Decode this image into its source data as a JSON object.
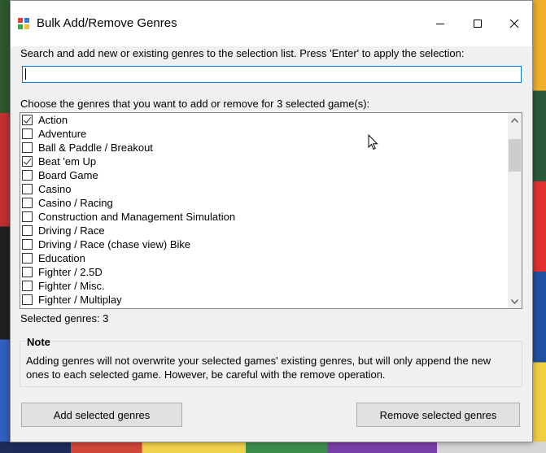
{
  "window": {
    "title": "Bulk Add/Remove Genres"
  },
  "search": {
    "label": "Search and add new or existing genres to the selection list. Press 'Enter' to apply the selection:",
    "value": "",
    "placeholder": ""
  },
  "genres": {
    "label": "Choose the genres that you want to add or remove for 3 selected game(s):",
    "items": [
      {
        "label": "Action",
        "checked": true
      },
      {
        "label": "Adventure",
        "checked": false
      },
      {
        "label": "Ball & Paddle / Breakout",
        "checked": false
      },
      {
        "label": "Beat 'em Up",
        "checked": true
      },
      {
        "label": "Board Game",
        "checked": false
      },
      {
        "label": "Casino",
        "checked": false
      },
      {
        "label": "Casino / Racing",
        "checked": false
      },
      {
        "label": "Construction and Management Simulation",
        "checked": false
      },
      {
        "label": "Driving / Race",
        "checked": false
      },
      {
        "label": "Driving / Race (chase view) Bike",
        "checked": false
      },
      {
        "label": "Education",
        "checked": false
      },
      {
        "label": "Fighter / 2.5D",
        "checked": false
      },
      {
        "label": "Fighter / Misc.",
        "checked": false
      },
      {
        "label": "Fighter / Multiplay",
        "checked": false
      }
    ],
    "selected_count_text": "Selected genres: 3",
    "scroll_fraction": 0.09
  },
  "note": {
    "title": "Note",
    "text": "Adding genres will not overwrite your selected games' existing genres, but will only append the new ones to each selected game. However, be careful with the remove operation."
  },
  "buttons": {
    "add_label": "Add selected genres",
    "remove_label": "Remove selected genres"
  },
  "colors": {
    "focus_border": "#0078d7",
    "dialog_bg": "#f0f0f0"
  }
}
